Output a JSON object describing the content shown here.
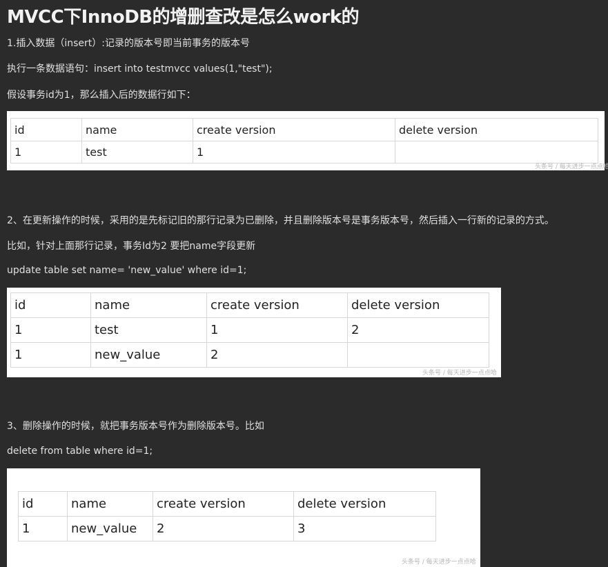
{
  "title": "MVCC下InnoDB的增删查改是怎么work的",
  "sections": [
    {
      "lines": [
        "1.插入数据（insert）:记录的版本号即当前事务的版本号",
        "执行一条数据语句：insert into testmvcc values(1,\"test\");",
        "假设事务id为1，那么插入后的数据行如下："
      ],
      "table": {
        "headers": [
          "id",
          "name",
          "create version",
          "delete version"
        ],
        "rows": [
          [
            "1",
            "test",
            "1",
            ""
          ]
        ]
      },
      "watermark": "头条号 / 每天进步一点点哈"
    },
    {
      "lines": [
        "2、在更新操作的时候，采用的是先标记旧的那行记录为已删除，并且删除版本号是事务版本号，然后插入一行新的记录的方式。",
        "比如，针对上面那行记录，事务Id为2 要把name字段更新",
        "update table set name= 'new_value' where id=1;"
      ],
      "table": {
        "headers": [
          "id",
          "name",
          "create version",
          "delete version"
        ],
        "rows": [
          [
            "1",
            "test",
            "1",
            "2"
          ],
          [
            "1",
            "new_value",
            "2",
            ""
          ]
        ]
      },
      "watermark": "头条号 / 每天进步一点点哈"
    },
    {
      "lines": [
        "3、删除操作的时候，就把事务版本号作为删除版本号。比如",
        "delete from table where id=1;"
      ],
      "table": {
        "headers": [
          "id",
          "name",
          "create version",
          "delete version"
        ],
        "rows": [
          [
            "1",
            "new_value",
            "2",
            "3"
          ]
        ]
      },
      "watermark": "头条号 / 每天进步一点点哈"
    }
  ]
}
